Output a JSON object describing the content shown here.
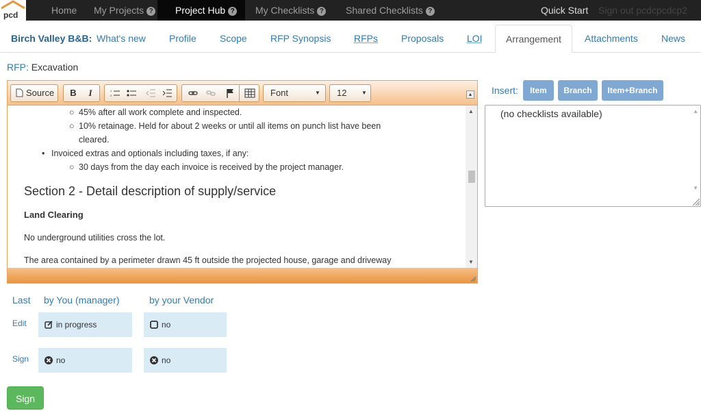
{
  "topbar": {
    "logo_text": "pcd",
    "items": [
      {
        "label": "Home"
      },
      {
        "label": "My Projects"
      },
      {
        "label": "Project Hub"
      },
      {
        "label": "My Checklists"
      },
      {
        "label": "Shared Checklists"
      }
    ],
    "quick_start": "Quick Start",
    "sign_out": "Sign out pcdcpcdcp2"
  },
  "tabs": {
    "brand": "Birch Valley B&B:",
    "items": [
      "What's new",
      "Profile",
      "Scope",
      "RFP Synopsis",
      "RFPs",
      "Proposals",
      "LOI",
      "Arrangement",
      "Attachments",
      "News"
    ]
  },
  "rfp": {
    "label": "RFP:",
    "value": "Excavation"
  },
  "editor": {
    "toolbar": {
      "source": "Source",
      "font": "Font",
      "size": "12"
    },
    "lines": [
      "45% after all work complete and inspected.",
      "10% retainage. Held for about 2 weeks or until all items on punch list have been",
      "cleared.",
      "Invoiced extras and optionals including taxes, if any:",
      "30 days from the day each invoice is received by the project manager.",
      "Section 2 - Detail description of supply/service",
      "Land Clearing",
      "No underground utilities cross the lot.",
      "The area contained by a perimeter drawn 45 ft outside the projected house, garage and driveway"
    ]
  },
  "insert": {
    "label": "Insert:",
    "buttons": [
      "Item",
      "Branch",
      "Item+Branch"
    ],
    "empty_text": "(no checklists available)"
  },
  "status": {
    "col_last": "Last",
    "col_you": "by You (manager)",
    "col_vendor": "by your Vendor",
    "row_edit": "Edit",
    "row_sign": "Sign",
    "edit_you": "in progress",
    "edit_vendor": "no",
    "sign_you": "no",
    "sign_vendor": "no"
  },
  "sign_button": "Sign",
  "colors": {
    "accent": "#337ab7",
    "editor_orange": "#e8953e",
    "status_cell": "#d9ebf5",
    "sign_green": "#5cb85c"
  }
}
